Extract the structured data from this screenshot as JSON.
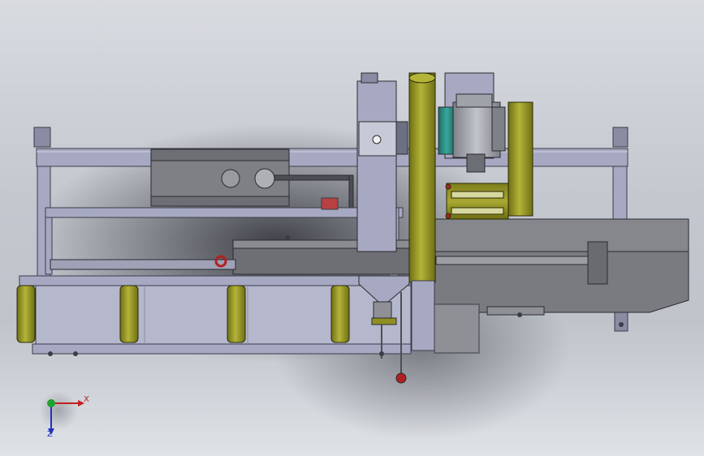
{
  "view": {
    "axes": {
      "x_label": "X",
      "z_label": "Z"
    },
    "colors": {
      "frame": "#a7a9c2",
      "frame_dark": "#6d6f84",
      "roller": "#8f8f22",
      "motor_body": "#9fa2a9",
      "motor_flange": "#2e8f86",
      "handle": "#b02020",
      "housing": "#7b7c80"
    }
  }
}
